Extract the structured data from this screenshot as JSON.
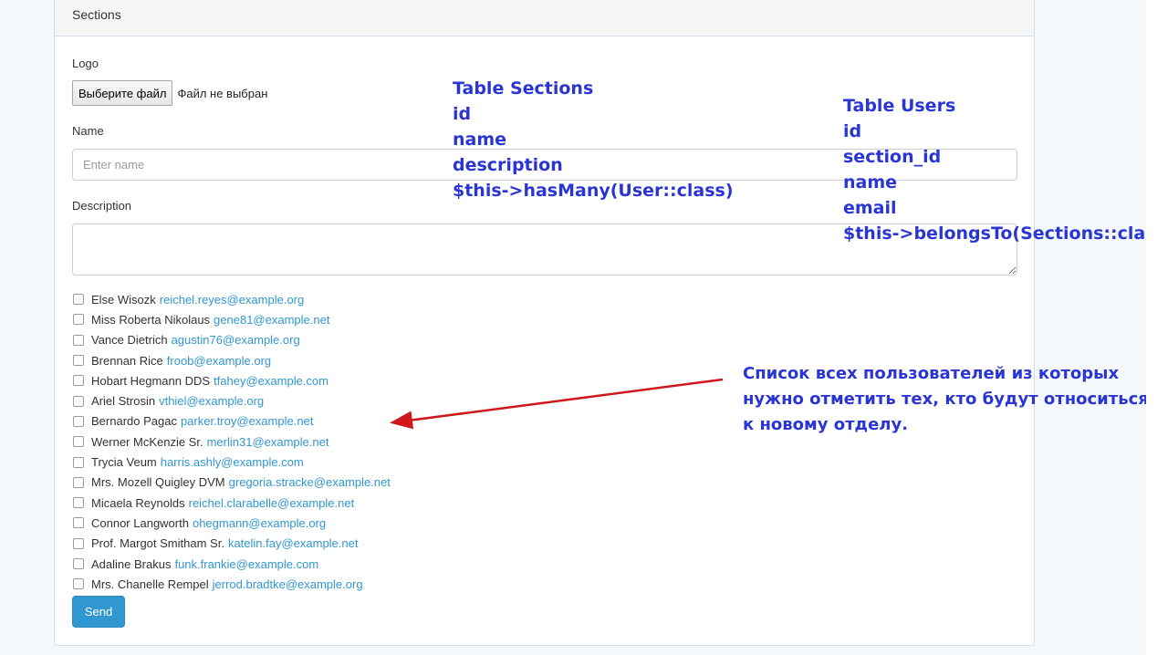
{
  "panel": {
    "title": "Sections"
  },
  "form": {
    "logo_label": "Logo",
    "file_button": "Выберите файл",
    "file_status": "Файл не выбран",
    "name_label": "Name",
    "name_placeholder": "Enter name",
    "description_label": "Description",
    "send_label": "Send"
  },
  "users": [
    {
      "name": "Else Wisozk",
      "email": "reichel.reyes@example.org"
    },
    {
      "name": "Miss Roberta Nikolaus",
      "email": "gene81@example.net"
    },
    {
      "name": "Vance Dietrich",
      "email": "agustin76@example.org"
    },
    {
      "name": "Brennan Rice",
      "email": "froob@example.org"
    },
    {
      "name": "Hobart Hegmann DDS",
      "email": "tfahey@example.com"
    },
    {
      "name": "Ariel Strosin",
      "email": "vthiel@example.org"
    },
    {
      "name": "Bernardo Pagac",
      "email": "parker.troy@example.net"
    },
    {
      "name": "Werner McKenzie Sr.",
      "email": "merlin31@example.net"
    },
    {
      "name": "Trycia Veum",
      "email": "harris.ashly@example.com"
    },
    {
      "name": "Mrs. Mozell Quigley DVM",
      "email": "gregoria.stracke@example.net"
    },
    {
      "name": "Micaela Reynolds",
      "email": "reichel.clarabelle@example.net"
    },
    {
      "name": "Connor Langworth",
      "email": "ohegmann@example.org"
    },
    {
      "name": "Prof. Margot Smitham Sr.",
      "email": "katelin.fay@example.net"
    },
    {
      "name": "Adaline Brakus",
      "email": "funk.frankie@example.com"
    },
    {
      "name": "Mrs. Chanelle Rempel",
      "email": "jerrod.bradtke@example.org"
    }
  ],
  "annotations": {
    "sections_table": [
      "Table Sections",
      "id",
      "name",
      "description",
      "$this->hasMany(User::class)"
    ],
    "users_table": [
      "Table Users",
      "id",
      "section_id",
      "name",
      "email",
      "$this->belongsTo(Sections::class)"
    ],
    "russian_note": [
      "Список всех пользователей из которых",
      "нужно отметить тех, кто будут относиться",
      "к новому отделу."
    ]
  },
  "colors": {
    "accent": "#3097d1",
    "annotation_text": "#2a35d6",
    "arrow": "#d0171d"
  }
}
